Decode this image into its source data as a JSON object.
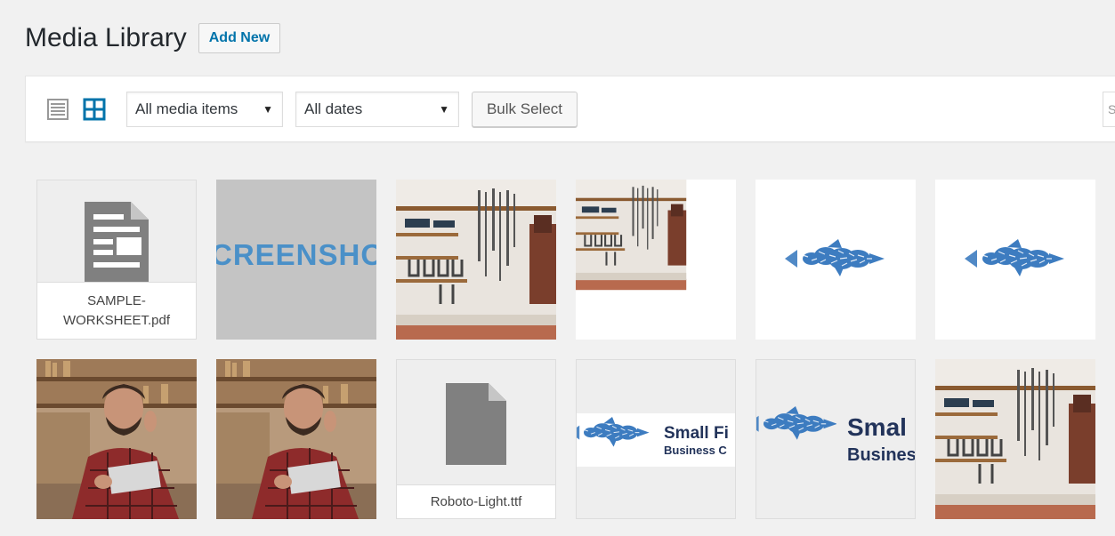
{
  "header": {
    "title": "Media Library",
    "add_new_label": "Add New"
  },
  "toolbar": {
    "type_filter": {
      "selected": "All media items"
    },
    "date_filter": {
      "selected": "All dates"
    },
    "bulk_select_label": "Bulk Select",
    "search_placeholder": "S",
    "active_view": "grid"
  },
  "media": [
    {
      "kind": "document",
      "filename_line1": "SAMPLE-",
      "filename_line2": "WORKSHEET.pdf"
    },
    {
      "kind": "image",
      "image_text": "CREENSHO"
    },
    {
      "kind": "image",
      "subject": "tool-wall"
    },
    {
      "kind": "image",
      "subject": "tool-wall-cropped"
    },
    {
      "kind": "image",
      "subject": "fish-school"
    },
    {
      "kind": "image",
      "subject": "fish-school"
    },
    {
      "kind": "image",
      "subject": "man-with-tablet"
    },
    {
      "kind": "image",
      "subject": "man-with-tablet"
    },
    {
      "kind": "file",
      "filename": "Roboto-Light.ttf"
    },
    {
      "kind": "image",
      "subject": "small-fish-logo",
      "logo_line1": "Small Fi",
      "logo_line2": "Business C"
    },
    {
      "kind": "image",
      "subject": "small-fish-logo",
      "logo_line1": "Smal",
      "logo_line2": "Busines"
    },
    {
      "kind": "image",
      "subject": "tool-wall"
    }
  ],
  "colors": {
    "accent": "#0073aa",
    "background": "#f1f1f1",
    "fish": "#3d7cc0",
    "logo_text": "#22335a"
  }
}
